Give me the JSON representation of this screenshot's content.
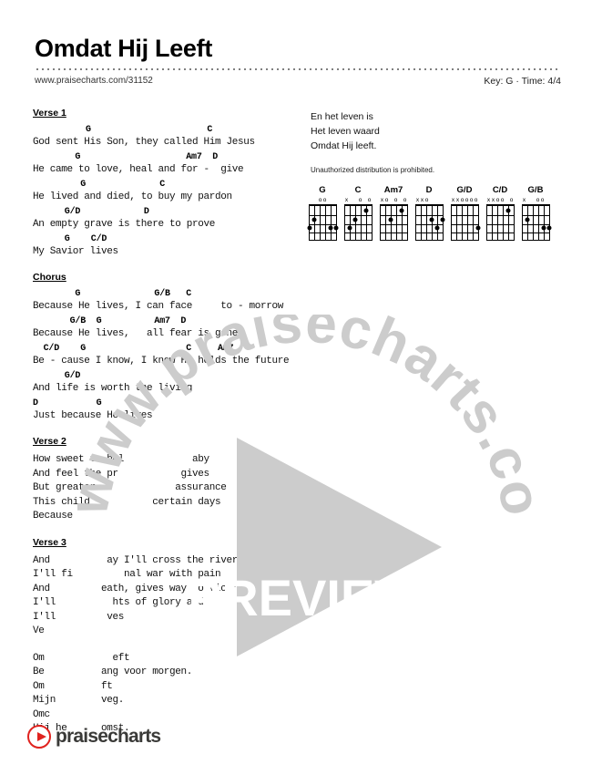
{
  "header": {
    "title": "Omdat Hij Leeft",
    "url": "www.praischarts.com/31152",
    "url_display": "www.praisecharts.com/31152",
    "key_time": "Key: G · Time: 4/4"
  },
  "sections": [
    {
      "label": "Verse 1",
      "lines": [
        {
          "chords": "          G                      C",
          "lyrics": "God sent His Son, they called Him Jesus"
        },
        {
          "chords": "        G                    Am7  D",
          "lyrics": "He came to love, heal and for -  give"
        },
        {
          "chords": "         G              C",
          "lyrics": "He lived and died, to buy my pardon"
        },
        {
          "chords": "      G/D            D",
          "lyrics": "An empty grave is there to prove"
        },
        {
          "chords": "      G    C/D",
          "lyrics": "My Savior lives"
        }
      ]
    },
    {
      "label": "Chorus",
      "lines": [
        {
          "chords": "        G              G/B   C",
          "lyrics": "Because He lives, I can face     to - morrow"
        },
        {
          "chords": "       G/B  G          Am7  D",
          "lyrics": "Because He lives,   all fear is gone"
        },
        {
          "chords": "  C/D    G                   C     Am7",
          "lyrics": "Be - cause I know, I know He holds the future"
        },
        {
          "chords": "      G/D",
          "lyrics": "And life is worth the living"
        },
        {
          "chords": "D           G",
          "lyrics": "Just because He lives"
        }
      ]
    },
    {
      "label": "Verse 2",
      "plain_lines": [
        "How sweet to hol            aby",
        "And feel the pr           gives",
        "But greater              assurance",
        "This child           certain days",
        "Because"
      ]
    },
    {
      "label": "Verse 3",
      "plain_lines": [
        "And          ay I'll cross the river",
        "I'll fi         nal war with pain",
        "And         eath, gives way to vict'ry",
        "I'll          hts of glory and",
        "I'll         ves",
        "Ve"
      ]
    },
    {
      "label": "",
      "plain_lines": [
        "Om            eft",
        "Be          ang voor morgen.",
        "Om          ft",
        "Mijn        veg.",
        "Omc",
        "Hij he      omst."
      ]
    }
  ],
  "right_column": {
    "lines": [
      "En het leven is",
      "Het leven waard",
      "Omdat Hij leeft."
    ],
    "notice": "Unauthorized distribution is prohibited."
  },
  "chords": [
    {
      "name": "G",
      "markers": [
        "",
        "",
        "o",
        "o",
        "",
        ""
      ],
      "dots": [
        {
          "string": 6,
          "fret": 3
        },
        {
          "string": 5,
          "fret": 2
        },
        {
          "string": 2,
          "fret": 3
        },
        {
          "string": 1,
          "fret": 3
        }
      ]
    },
    {
      "name": "C",
      "markers": [
        "x",
        "",
        "",
        "o",
        "",
        "o"
      ],
      "dots": [
        {
          "string": 5,
          "fret": 3
        },
        {
          "string": 4,
          "fret": 2
        },
        {
          "string": 2,
          "fret": 1
        }
      ]
    },
    {
      "name": "Am7",
      "markers": [
        "x",
        "o",
        "",
        "o",
        "",
        "o"
      ],
      "dots": [
        {
          "string": 4,
          "fret": 2
        },
        {
          "string": 2,
          "fret": 1
        }
      ]
    },
    {
      "name": "D",
      "markers": [
        "x",
        "x",
        "o",
        "",
        "",
        ""
      ],
      "dots": [
        {
          "string": 3,
          "fret": 2
        },
        {
          "string": 2,
          "fret": 3
        },
        {
          "string": 1,
          "fret": 2
        }
      ]
    },
    {
      "name": "G/D",
      "markers": [
        "x",
        "x",
        "o",
        "o",
        "o",
        "o"
      ],
      "dots": [
        {
          "string": 1,
          "fret": 3
        }
      ]
    },
    {
      "name": "C/D",
      "markers": [
        "x",
        "x",
        "o",
        "o",
        "",
        "o"
      ],
      "dots": [
        {
          "string": 2,
          "fret": 1
        }
      ]
    },
    {
      "name": "G/B",
      "markers": [
        "x",
        "",
        "",
        "o",
        "o",
        ""
      ],
      "dots": [
        {
          "string": 5,
          "fret": 2
        },
        {
          "string": 2,
          "fret": 3
        },
        {
          "string": 1,
          "fret": 3
        }
      ]
    }
  ],
  "watermark": {
    "arc_text": "www.praisecharts.com",
    "preview_text": "PREVIEW",
    "color": "#cccccc"
  },
  "footer": {
    "logo_text": "praisecharts",
    "logo_accent": "#e0231f"
  }
}
